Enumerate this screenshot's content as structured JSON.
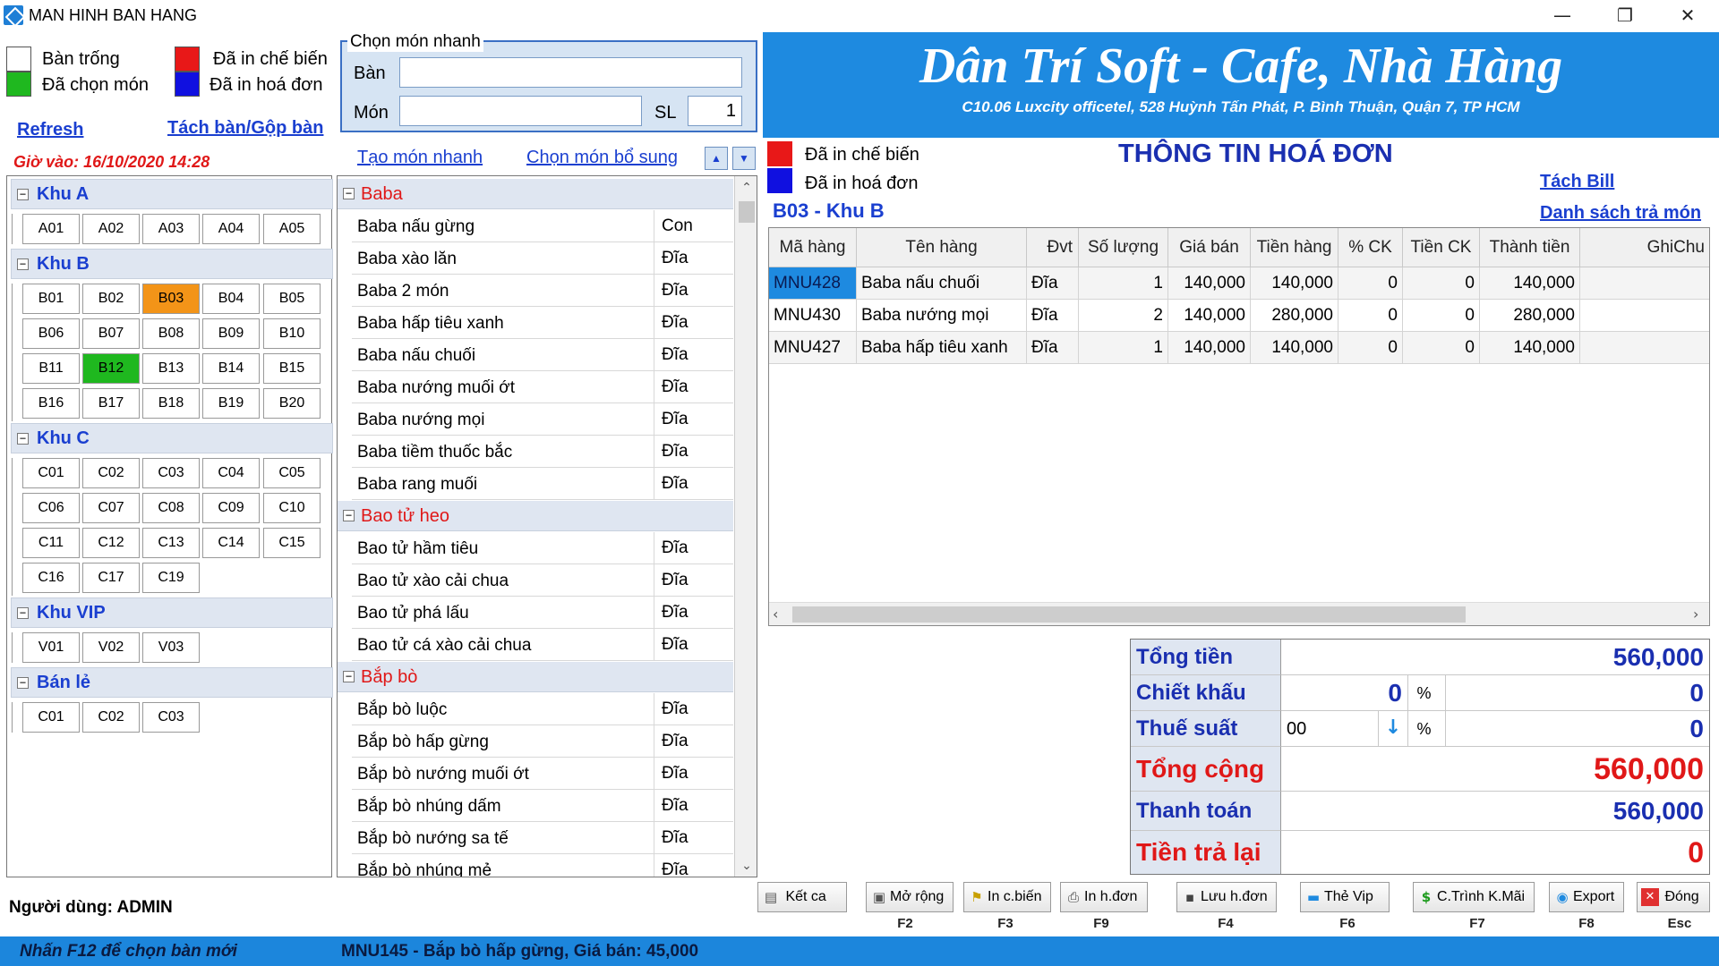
{
  "window": {
    "title": "MAN HINH BAN HANG",
    "minimize": "—",
    "restore": "❐",
    "close": "✕"
  },
  "legend_left": {
    "empty": "Bàn trống",
    "selected": "Đã chọn món",
    "printed_kitchen": "Đã in chế biến",
    "printed_invoice": "Đã in hoá đơn"
  },
  "colors": {
    "empty": "#ffffff",
    "selected": "#1fb81f",
    "printed_kitchen": "#e81818",
    "printed_invoice": "#1010e0",
    "active_table": "#f39418"
  },
  "left_links": {
    "refresh": "Refresh",
    "split_merge": "Tách bàn/Gộp bàn"
  },
  "checkin_time": "Giờ vào: 16/10/2020 14:28",
  "zones": [
    {
      "name": "Khu A",
      "tables": [
        "A01",
        "A02",
        "A03",
        "A04",
        "A05"
      ]
    },
    {
      "name": "Khu B",
      "tables": [
        "B01",
        "B02",
        "B03",
        "B04",
        "B05",
        "B06",
        "B07",
        "B08",
        "B09",
        "B10",
        "B11",
        "B12",
        "B13",
        "B14",
        "B15",
        "B16",
        "B17",
        "B18",
        "B19",
        "B20"
      ]
    },
    {
      "name": "Khu C",
      "tables": [
        "C01",
        "C02",
        "C03",
        "C04",
        "C05",
        "C06",
        "C07",
        "C08",
        "C09",
        "C10",
        "C11",
        "C12",
        "C13",
        "C14",
        "C15",
        "C16",
        "C17",
        "C19"
      ]
    },
    {
      "name": "Khu VIP",
      "tables": [
        "V01",
        "V02",
        "V03"
      ]
    },
    {
      "name": "Bán lẻ",
      "tables": [
        "C01",
        "C02",
        "C03"
      ]
    }
  ],
  "table_status": {
    "B03": "active_table",
    "B12": "selected"
  },
  "quick_select": {
    "legend": "Chọn món nhanh",
    "table_label": "Bàn",
    "table_value": "",
    "item_label": "Món",
    "item_value": "",
    "qty_label": "SL",
    "qty_value": "1"
  },
  "menu_links": {
    "quick_create": "Tạo món nhanh",
    "add_extra": "Chọn món bổ sung",
    "up": "▲",
    "down": "▼"
  },
  "menu_groups": [
    {
      "name": "Baba",
      "items": [
        {
          "name": "Baba nấu gừng",
          "unit": "Con"
        },
        {
          "name": "Baba xào lăn",
          "unit": "Đĩa"
        },
        {
          "name": "Baba 2 món",
          "unit": "Đĩa"
        },
        {
          "name": "Baba hấp tiêu xanh",
          "unit": "Đĩa"
        },
        {
          "name": "Baba nấu chuối",
          "unit": "Đĩa"
        },
        {
          "name": "Baba nướng muối ớt",
          "unit": "Đĩa"
        },
        {
          "name": "Baba nướng mọi",
          "unit": "Đĩa"
        },
        {
          "name": "Baba tiềm thuốc bắc",
          "unit": "Đĩa"
        },
        {
          "name": "Baba rang muối",
          "unit": "Đĩa"
        }
      ]
    },
    {
      "name": "Bao tử heo",
      "items": [
        {
          "name": "Bao tử hầm tiêu",
          "unit": "Đĩa"
        },
        {
          "name": "Bao tử xào cải chua",
          "unit": "Đĩa"
        },
        {
          "name": "Bao tử phá lấu",
          "unit": "Đĩa"
        },
        {
          "name": "Bao tử cá xào cải chua",
          "unit": "Đĩa"
        }
      ]
    },
    {
      "name": "Bắp bò",
      "items": [
        {
          "name": "Bắp bò luộc",
          "unit": "Đĩa"
        },
        {
          "name": "Bắp bò hấp gừng",
          "unit": "Đĩa"
        },
        {
          "name": "Bắp bò nướng muối ớt",
          "unit": "Đĩa"
        },
        {
          "name": "Bắp bò nhúng dấm",
          "unit": "Đĩa"
        },
        {
          "name": "Bắp bò nướng sa tế",
          "unit": "Đĩa"
        },
        {
          "name": "Bắp bò nhúng mẻ",
          "unit": "Đĩa"
        }
      ]
    }
  ],
  "banner": {
    "title": "Dân Trí Soft - Cafe, Nhà Hàng",
    "address": "C10.06 Luxcity officetel, 528 Huỳnh Tấn Phát, P. Bình Thuận, Quận 7, TP HCM"
  },
  "legend_right": {
    "printed_kitchen": "Đã in chế biến",
    "printed_invoice": "Đã in hoá đơn"
  },
  "invoice": {
    "title": "THÔNG TIN HOÁ ĐƠN",
    "table": "B03 - Khu B",
    "split_bill": "Tách Bill",
    "return_list": "Danh sách trả món",
    "columns": [
      "Mã hàng",
      "Tên hàng",
      "Đvt",
      "Số lượng",
      "Giá bán",
      "Tiền hàng",
      "% CK",
      "Tiền CK",
      "Thành tiền",
      "GhiChu"
    ],
    "rows": [
      [
        "MNU428",
        "Baba nấu chuối",
        "Đĩa",
        "1",
        "140,000",
        "140,000",
        "0",
        "0",
        "140,000",
        ""
      ],
      [
        "MNU430",
        "Baba nướng mọi",
        "Đĩa",
        "2",
        "140,000",
        "280,000",
        "0",
        "0",
        "280,000",
        ""
      ],
      [
        "MNU427",
        "Baba hấp tiêu xanh",
        "Đĩa",
        "1",
        "140,000",
        "140,000",
        "0",
        "0",
        "140,000",
        ""
      ]
    ]
  },
  "totals": {
    "subtotal_label": "Tổng tiền",
    "subtotal": "560,000",
    "discount_label": "Chiết khấu",
    "discount_pct": "0",
    "discount_value": "0",
    "tax_label": "Thuế suất",
    "tax_rate": "00",
    "tax_value": "0",
    "pct": "%",
    "total_label": "Tổng cộng",
    "total": "560,000",
    "payment_label": "Thanh toán",
    "payment": "560,000",
    "change_label": "Tiền trả lại",
    "change": "0"
  },
  "user": "Người dùng: ADMIN",
  "toolbar": [
    {
      "label": "Kết ca",
      "key": "",
      "icon": "shift-icon"
    },
    {
      "label": "Mở rộng",
      "key": "F2",
      "icon": "expand-icon"
    },
    {
      "label": "In c.biến",
      "key": "F3",
      "icon": "kitchen-print-icon"
    },
    {
      "label": "In h.đơn",
      "key": "F9",
      "icon": "printer-icon"
    },
    {
      "label": "Lưu h.đơn",
      "key": "F4",
      "icon": "save-icon"
    },
    {
      "label": "Thẻ Vip",
      "key": "F6",
      "icon": "card-icon"
    },
    {
      "label": "C.Trình K.Mãi",
      "key": "F7",
      "icon": "promo-icon"
    },
    {
      "label": "Export",
      "key": "F8",
      "icon": "export-icon"
    },
    {
      "label": "Đóng",
      "key": "Esc",
      "icon": "close-icon"
    }
  ],
  "status": {
    "hint": "Nhấn F12 để chọn bàn mới",
    "selected_item": "MNU145 - Bắp bò hấp gừng, Giá bán: 45,000"
  }
}
